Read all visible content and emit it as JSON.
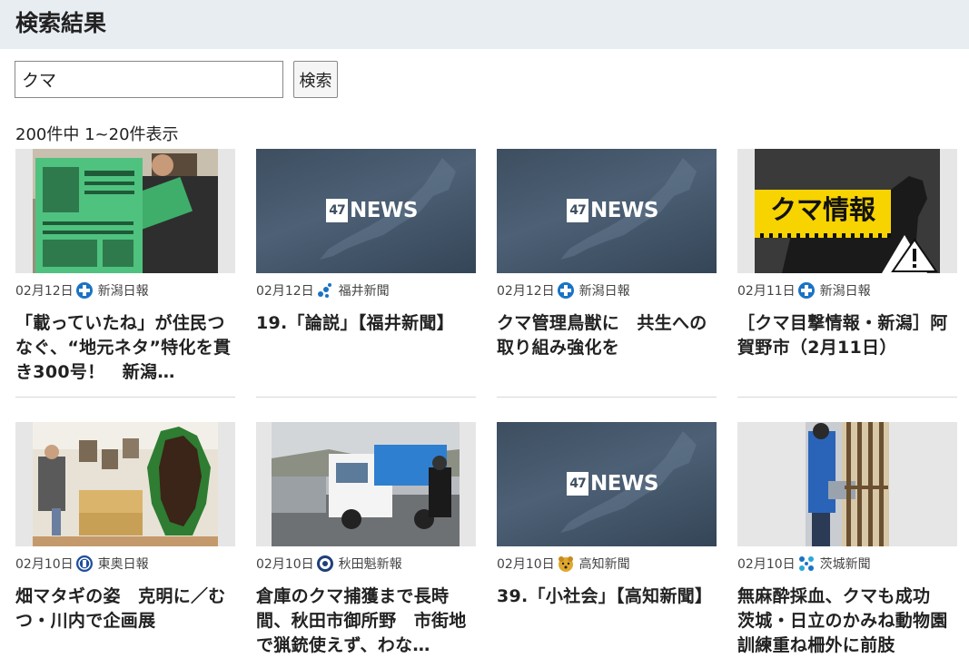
{
  "header": {
    "title": "検索結果"
  },
  "search": {
    "value": "クマ",
    "button_label": "検索"
  },
  "results_summary": "200件中 1~20件表示",
  "colors": {
    "header_bg": "#e8edf2",
    "kuma_yellow": "#f7d300",
    "news47_bg": "#3f4f61"
  },
  "articles": [
    {
      "date": "02月12日",
      "source": "新潟日報",
      "source_icon": "niigata-nippo-logo-icon",
      "thumbnail": "newspaper-reader-photo",
      "headline": "「載っていたね」が住民つなぐ、“地元ネタ”特化を貫き300号！　新潟…"
    },
    {
      "date": "02月12日",
      "source": "福井新聞",
      "source_icon": "fukui-shimbun-logo-icon",
      "thumbnail": "47news-logo",
      "thumb_logo_box": "47",
      "thumb_logo_word": "NEWS",
      "headline": "19.「論説」【福井新聞】"
    },
    {
      "date": "02月12日",
      "source": "新潟日報",
      "source_icon": "niigata-nippo-logo-icon",
      "thumbnail": "47news-logo",
      "thumb_logo_box": "47",
      "thumb_logo_word": "NEWS",
      "headline": "クマ管理鳥獣に　共生への取り組み強化を"
    },
    {
      "date": "02月11日",
      "source": "新潟日報",
      "source_icon": "niigata-nippo-logo-icon",
      "thumbnail": "bear-warning-graphic",
      "thumb_label": "クマ情報",
      "headline": "［クマ目撃情報・新潟］阿賀野市（2月11日）"
    },
    {
      "date": "02月10日",
      "source": "東奥日報",
      "source_icon": "toon-nippo-logo-icon",
      "thumbnail": "matagi-exhibition-photo",
      "headline": "畑マタギの姿　克明に／むつ・川内で企画展"
    },
    {
      "date": "02月10日",
      "source": "秋田魁新報",
      "source_icon": "akita-sakigake-logo-icon",
      "thumbnail": "bear-capture-truck-photo",
      "headline": "倉庫のクマ捕獲まで長時間、秋田市御所野　市街地で猟銃使えず、わな…"
    },
    {
      "date": "02月10日",
      "source": "高知新聞",
      "source_icon": "kochi-shimbun-logo-icon",
      "thumbnail": "47news-logo",
      "thumb_logo_box": "47",
      "thumb_logo_word": "NEWS",
      "headline": "39.「小社会」【高知新聞】"
    },
    {
      "date": "02月10日",
      "source": "茨城新聞",
      "source_icon": "ibaraki-shimbun-logo-icon",
      "thumbnail": "zoo-keeper-training-photo",
      "headline": "無麻酔採血、クマも成功　茨城・日立のかみね動物園　訓練重ね柵外に前肢"
    }
  ]
}
